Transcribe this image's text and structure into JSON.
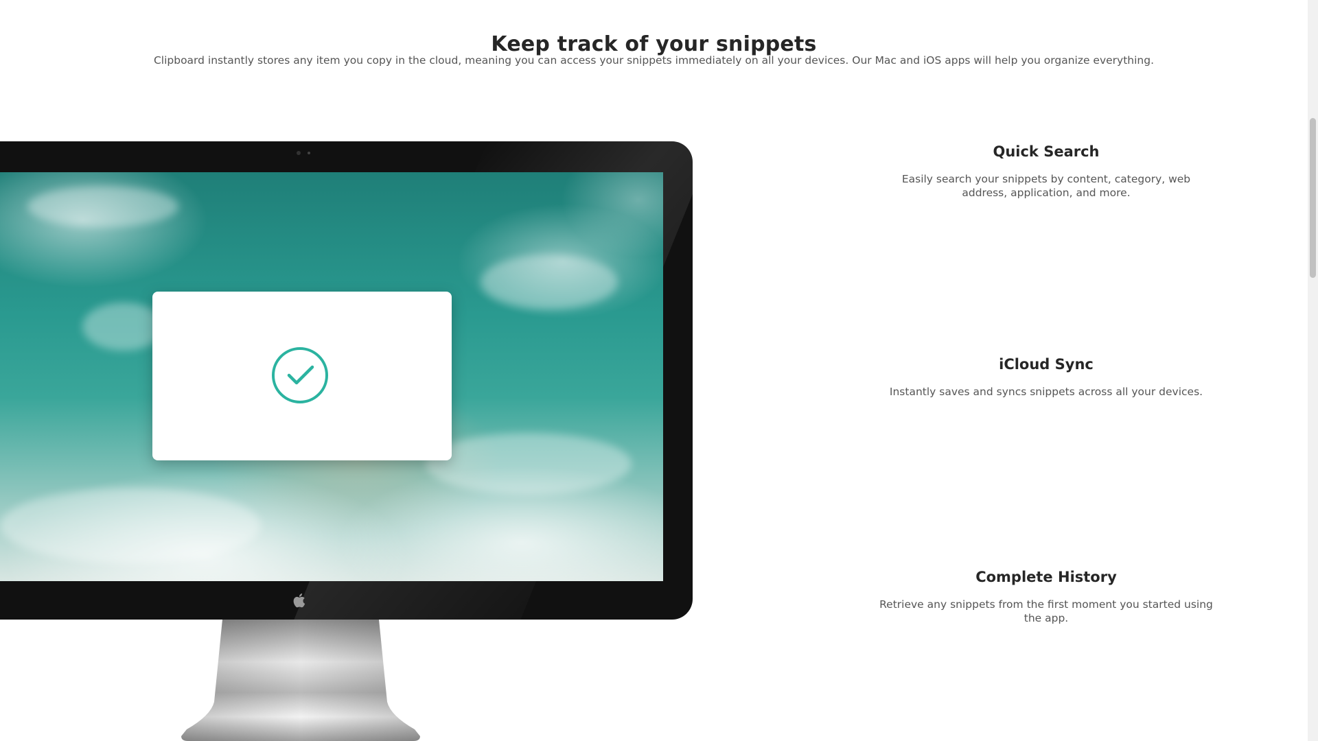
{
  "section": {
    "title": "Keep track of your snippets",
    "description": "Clipboard instantly stores any item you copy in the cloud, meaning you can access your snippets immediately on all your devices. Our Mac and iOS apps will help you organize everything."
  },
  "features": [
    {
      "title": "Quick Search",
      "description": "Easily search your snippets by content, category, web address, application, and more."
    },
    {
      "title": "iCloud Sync",
      "description": "Instantly saves and syncs snippets across all your devices."
    },
    {
      "title": "Complete History",
      "description": "Retrieve any snippets from the first moment you started using the app."
    }
  ],
  "colors": {
    "accent": "#2bb3a0",
    "heading": "#262626",
    "body_text": "#555555",
    "monitor_bezel": "#111111"
  },
  "icons": {
    "check": "check-circle-icon",
    "apple": "apple-logo-icon"
  }
}
